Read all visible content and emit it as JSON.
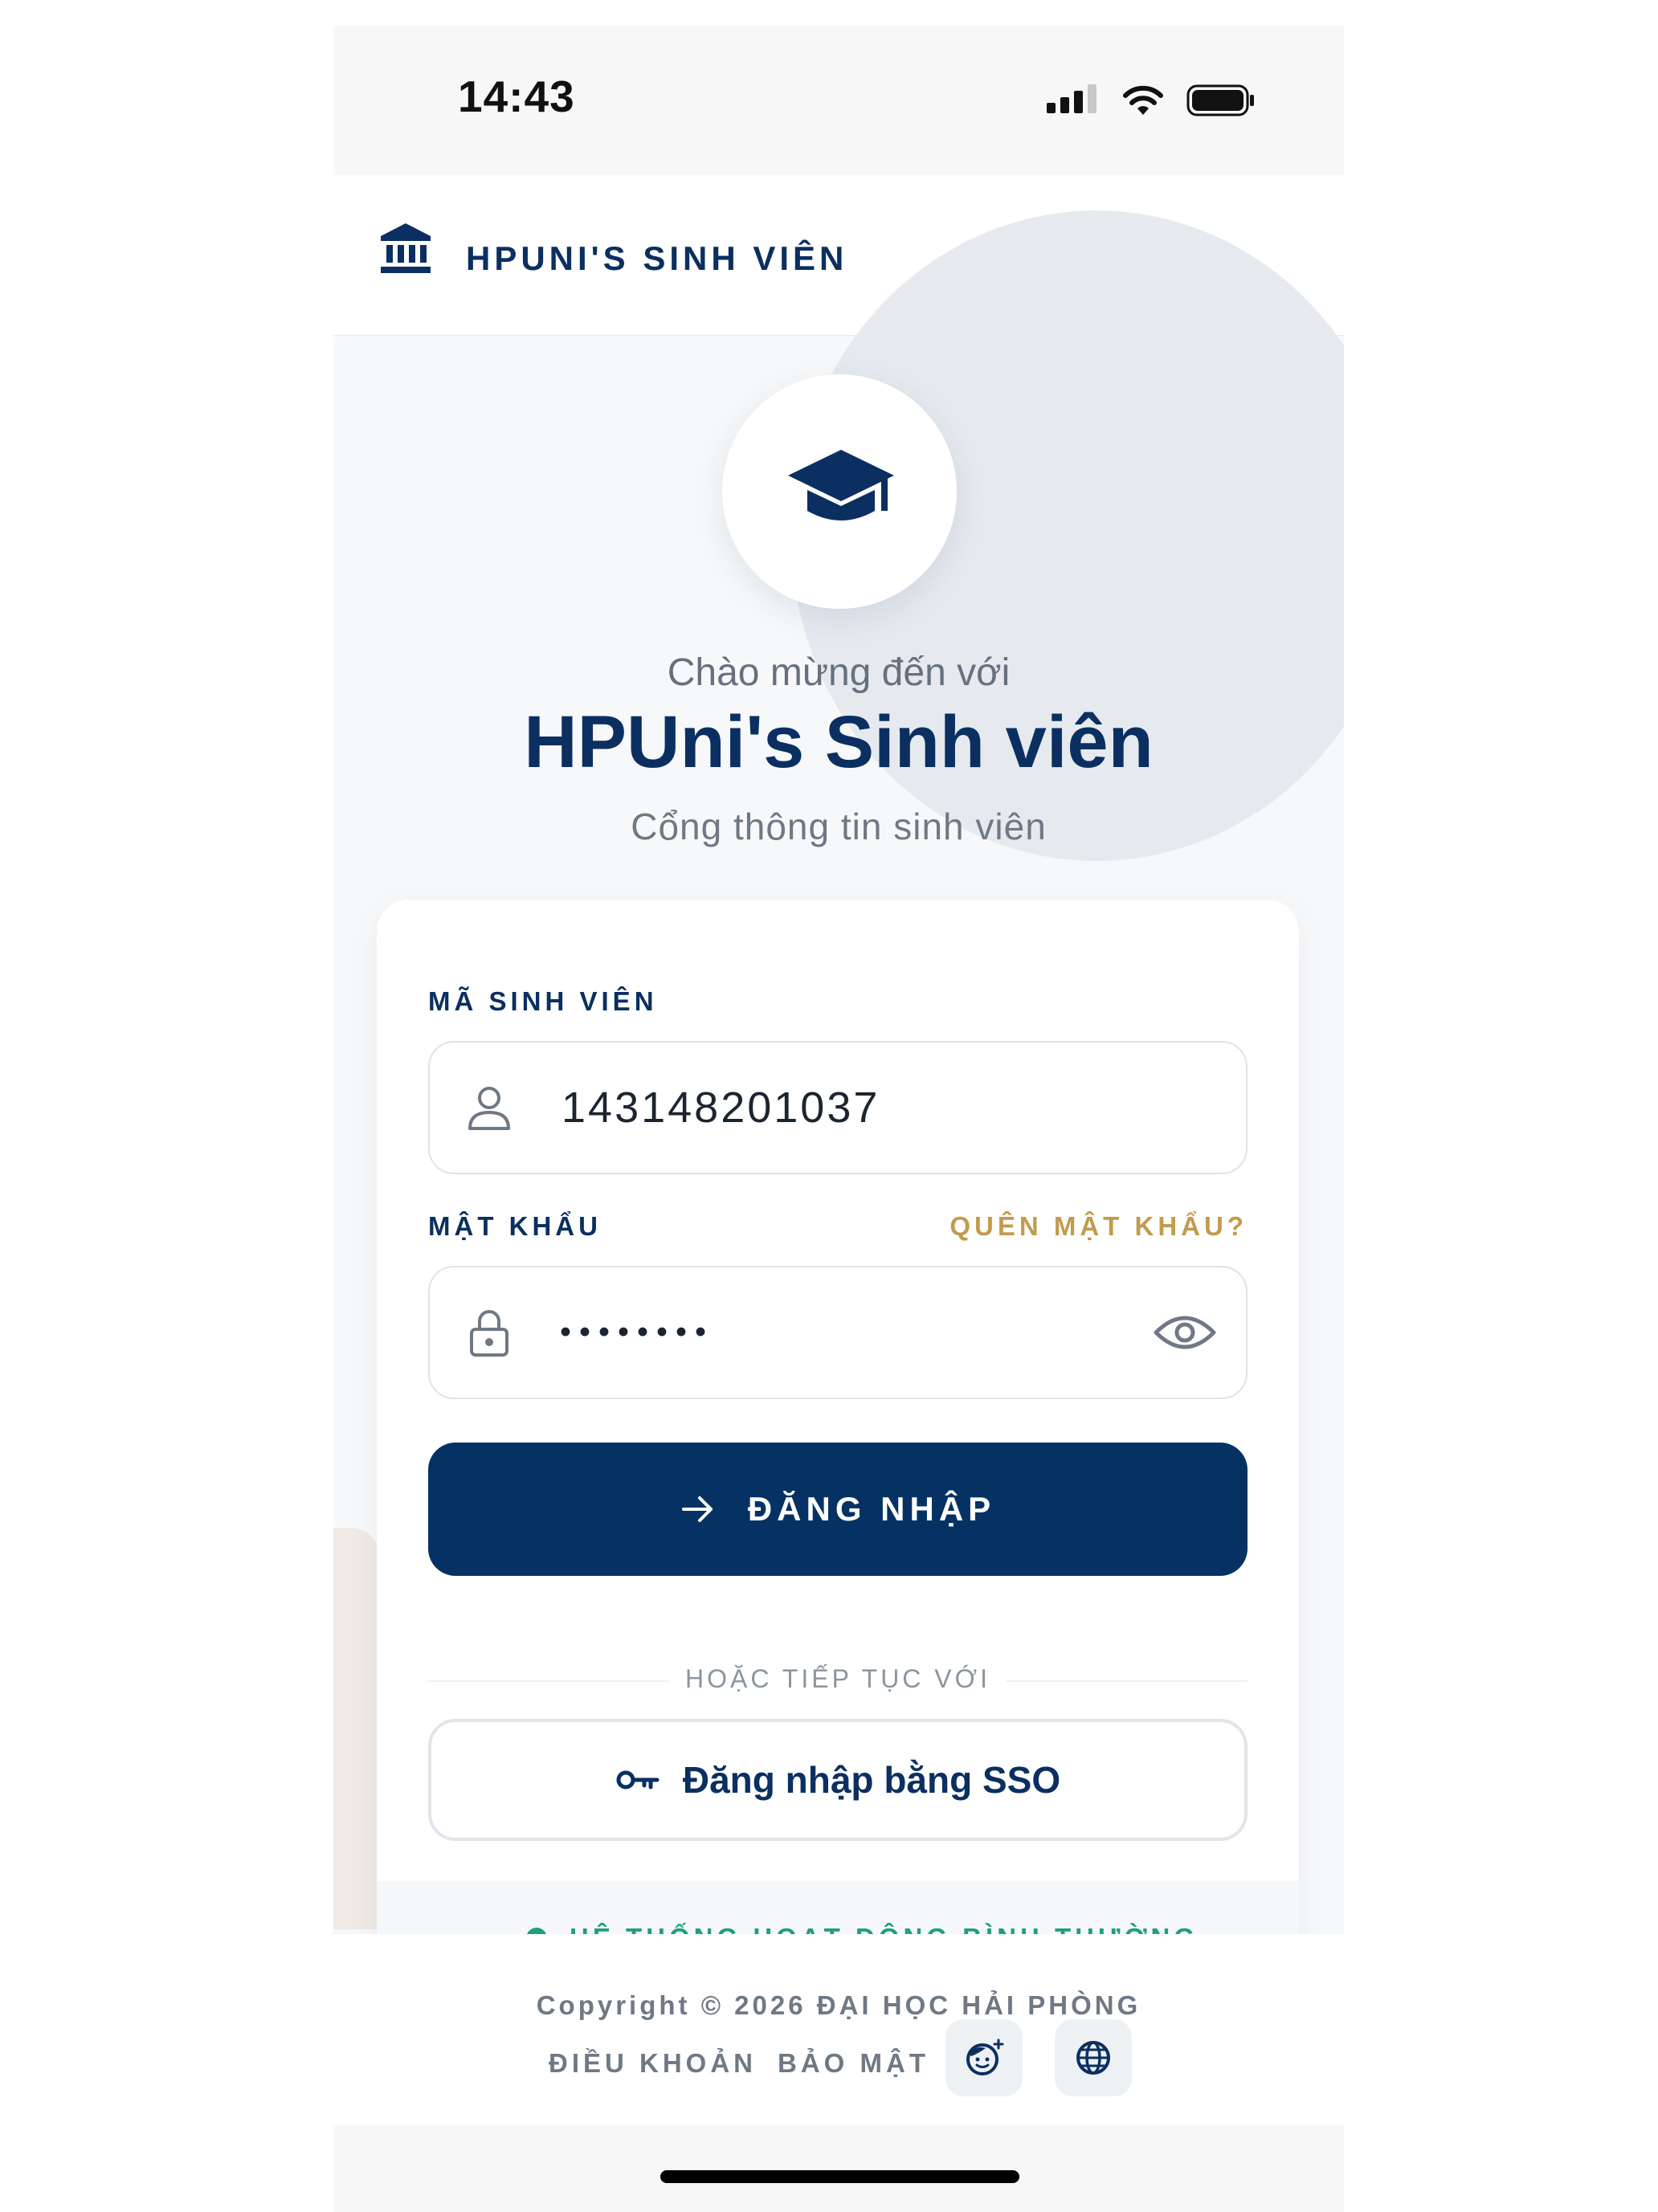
{
  "status_bar": {
    "time": "14:43"
  },
  "app_bar": {
    "title": "HPUNI'S SINH VIÊN",
    "logo_icon": "university-building-icon"
  },
  "hero": {
    "icon": "graduation-cap-icon",
    "welcome": "Chào mừng đến với",
    "title": "HPUni's Sinh viên",
    "subtitle": "Cổng thông tin sinh viên"
  },
  "form": {
    "student_id_label": "MÃ SINH VIÊN",
    "student_id_value": "143148201037",
    "password_label": "MẬT KHẨU",
    "forgot_label": "QUÊN MẬT KHẨU?",
    "password_value": "••••••••",
    "login_label": "ĐĂNG NHẬP",
    "divider_text": "HOẶC TIẾP TỤC VỚI",
    "sso_label": "Đăng nhập bằng SSO"
  },
  "system_status": {
    "text": "HỆ THỐNG HOẠT ĐỘNG BÌNH THƯỜNG",
    "color": "#1ea07a"
  },
  "footer": {
    "copyright": "Copyright © 2026 ĐẠI HỌC HẢI PHÒNG",
    "terms": "ĐIỀU KHOẢN",
    "privacy": "BẢO MẬT"
  },
  "colors": {
    "primary": "#053263",
    "accent": "#c29b4d",
    "muted": "#6f7985"
  }
}
